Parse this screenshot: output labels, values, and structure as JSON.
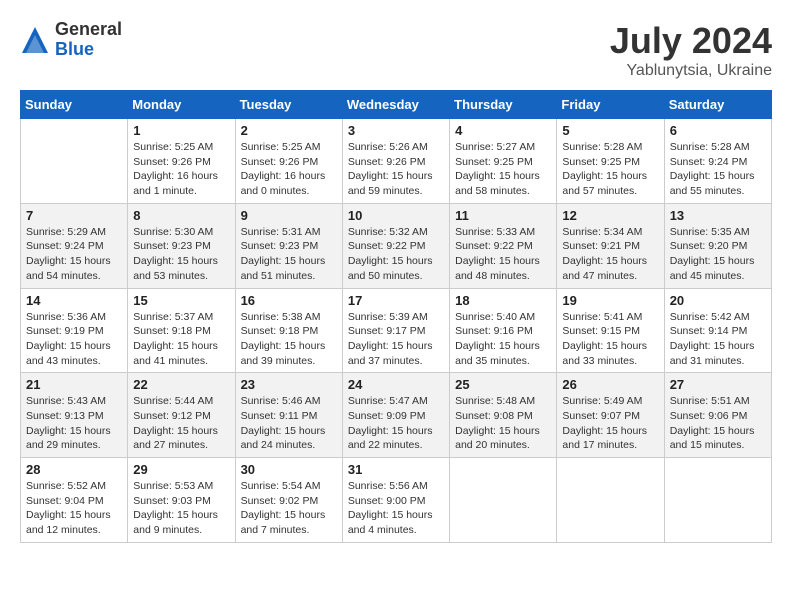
{
  "header": {
    "logo_general": "General",
    "logo_blue": "Blue",
    "title": "July 2024",
    "location": "Yablunytsia, Ukraine"
  },
  "days_of_week": [
    "Sunday",
    "Monday",
    "Tuesday",
    "Wednesday",
    "Thursday",
    "Friday",
    "Saturday"
  ],
  "weeks": [
    [
      {
        "day": "",
        "info": ""
      },
      {
        "day": "1",
        "info": "Sunrise: 5:25 AM\nSunset: 9:26 PM\nDaylight: 16 hours\nand 1 minute."
      },
      {
        "day": "2",
        "info": "Sunrise: 5:25 AM\nSunset: 9:26 PM\nDaylight: 16 hours\nand 0 minutes."
      },
      {
        "day": "3",
        "info": "Sunrise: 5:26 AM\nSunset: 9:26 PM\nDaylight: 15 hours\nand 59 minutes."
      },
      {
        "day": "4",
        "info": "Sunrise: 5:27 AM\nSunset: 9:25 PM\nDaylight: 15 hours\nand 58 minutes."
      },
      {
        "day": "5",
        "info": "Sunrise: 5:28 AM\nSunset: 9:25 PM\nDaylight: 15 hours\nand 57 minutes."
      },
      {
        "day": "6",
        "info": "Sunrise: 5:28 AM\nSunset: 9:24 PM\nDaylight: 15 hours\nand 55 minutes."
      }
    ],
    [
      {
        "day": "7",
        "info": "Sunrise: 5:29 AM\nSunset: 9:24 PM\nDaylight: 15 hours\nand 54 minutes."
      },
      {
        "day": "8",
        "info": "Sunrise: 5:30 AM\nSunset: 9:23 PM\nDaylight: 15 hours\nand 53 minutes."
      },
      {
        "day": "9",
        "info": "Sunrise: 5:31 AM\nSunset: 9:23 PM\nDaylight: 15 hours\nand 51 minutes."
      },
      {
        "day": "10",
        "info": "Sunrise: 5:32 AM\nSunset: 9:22 PM\nDaylight: 15 hours\nand 50 minutes."
      },
      {
        "day": "11",
        "info": "Sunrise: 5:33 AM\nSunset: 9:22 PM\nDaylight: 15 hours\nand 48 minutes."
      },
      {
        "day": "12",
        "info": "Sunrise: 5:34 AM\nSunset: 9:21 PM\nDaylight: 15 hours\nand 47 minutes."
      },
      {
        "day": "13",
        "info": "Sunrise: 5:35 AM\nSunset: 9:20 PM\nDaylight: 15 hours\nand 45 minutes."
      }
    ],
    [
      {
        "day": "14",
        "info": "Sunrise: 5:36 AM\nSunset: 9:19 PM\nDaylight: 15 hours\nand 43 minutes."
      },
      {
        "day": "15",
        "info": "Sunrise: 5:37 AM\nSunset: 9:18 PM\nDaylight: 15 hours\nand 41 minutes."
      },
      {
        "day": "16",
        "info": "Sunrise: 5:38 AM\nSunset: 9:18 PM\nDaylight: 15 hours\nand 39 minutes."
      },
      {
        "day": "17",
        "info": "Sunrise: 5:39 AM\nSunset: 9:17 PM\nDaylight: 15 hours\nand 37 minutes."
      },
      {
        "day": "18",
        "info": "Sunrise: 5:40 AM\nSunset: 9:16 PM\nDaylight: 15 hours\nand 35 minutes."
      },
      {
        "day": "19",
        "info": "Sunrise: 5:41 AM\nSunset: 9:15 PM\nDaylight: 15 hours\nand 33 minutes."
      },
      {
        "day": "20",
        "info": "Sunrise: 5:42 AM\nSunset: 9:14 PM\nDaylight: 15 hours\nand 31 minutes."
      }
    ],
    [
      {
        "day": "21",
        "info": "Sunrise: 5:43 AM\nSunset: 9:13 PM\nDaylight: 15 hours\nand 29 minutes."
      },
      {
        "day": "22",
        "info": "Sunrise: 5:44 AM\nSunset: 9:12 PM\nDaylight: 15 hours\nand 27 minutes."
      },
      {
        "day": "23",
        "info": "Sunrise: 5:46 AM\nSunset: 9:11 PM\nDaylight: 15 hours\nand 24 minutes."
      },
      {
        "day": "24",
        "info": "Sunrise: 5:47 AM\nSunset: 9:09 PM\nDaylight: 15 hours\nand 22 minutes."
      },
      {
        "day": "25",
        "info": "Sunrise: 5:48 AM\nSunset: 9:08 PM\nDaylight: 15 hours\nand 20 minutes."
      },
      {
        "day": "26",
        "info": "Sunrise: 5:49 AM\nSunset: 9:07 PM\nDaylight: 15 hours\nand 17 minutes."
      },
      {
        "day": "27",
        "info": "Sunrise: 5:51 AM\nSunset: 9:06 PM\nDaylight: 15 hours\nand 15 minutes."
      }
    ],
    [
      {
        "day": "28",
        "info": "Sunrise: 5:52 AM\nSunset: 9:04 PM\nDaylight: 15 hours\nand 12 minutes."
      },
      {
        "day": "29",
        "info": "Sunrise: 5:53 AM\nSunset: 9:03 PM\nDaylight: 15 hours\nand 9 minutes."
      },
      {
        "day": "30",
        "info": "Sunrise: 5:54 AM\nSunset: 9:02 PM\nDaylight: 15 hours\nand 7 minutes."
      },
      {
        "day": "31",
        "info": "Sunrise: 5:56 AM\nSunset: 9:00 PM\nDaylight: 15 hours\nand 4 minutes."
      },
      {
        "day": "",
        "info": ""
      },
      {
        "day": "",
        "info": ""
      },
      {
        "day": "",
        "info": ""
      }
    ]
  ]
}
